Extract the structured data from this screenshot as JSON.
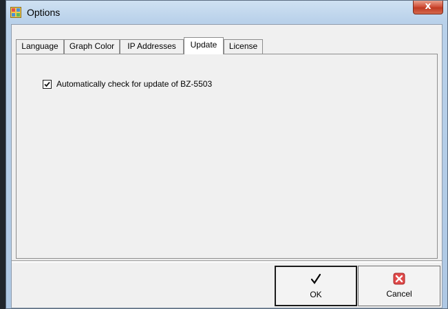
{
  "window": {
    "title": "Options",
    "close_glyph": "x",
    "icon": "options-app-icon"
  },
  "tabs": [
    {
      "label": "Language",
      "selected": false
    },
    {
      "label": "Graph Color",
      "selected": false
    },
    {
      "label": "IP Addresses",
      "selected": false
    },
    {
      "label": "Update",
      "selected": true
    },
    {
      "label": "License",
      "selected": false
    }
  ],
  "update_panel": {
    "auto_check_label": "Automatically check for update of BZ-5503",
    "auto_check_checked": true
  },
  "buttons": {
    "ok_label": "OK",
    "ok_icon": "checkmark-icon",
    "cancel_label": "Cancel",
    "cancel_icon": "red-x-icon"
  },
  "colors": {
    "close_button": "#c73b22",
    "cancel_icon": "#e04a4a"
  }
}
